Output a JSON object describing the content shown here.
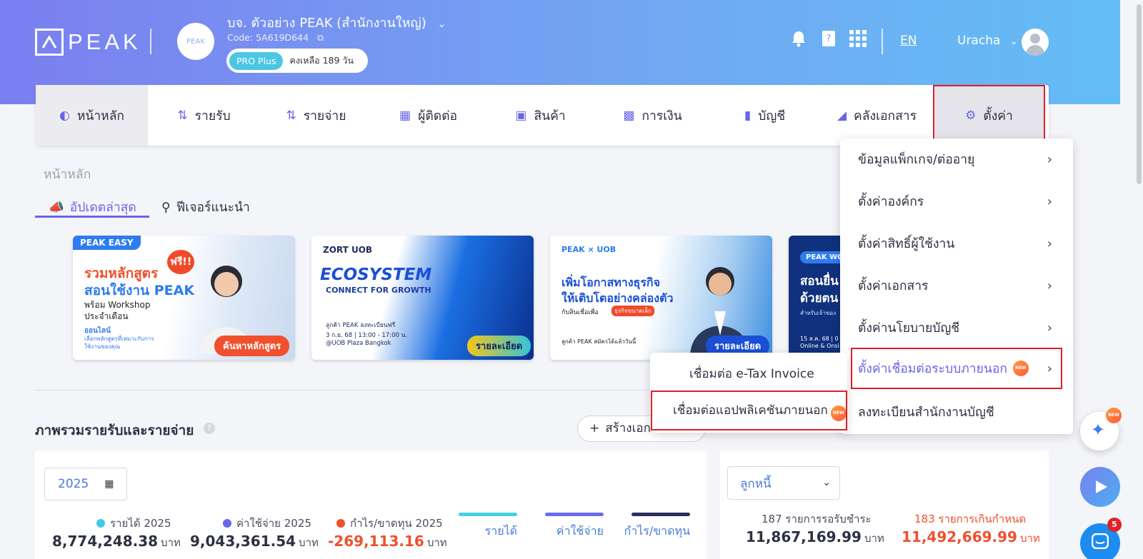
{
  "header": {
    "logo_text": "PEAK",
    "company_name": "บจ. ตัวอย่าง PEAK (สำนักงานใหญ่)",
    "company_logo_text": "PEAK",
    "company_code": "Code: 5A619D644",
    "plan_badge": "PRO Plus",
    "plan_days_left": "คงเหลือ 189 วัน",
    "language": "EN",
    "user_name": "Uracha"
  },
  "nav": {
    "items": [
      {
        "label": "หน้าหลัก",
        "icon": "chart-icon"
      },
      {
        "label": "รายรับ",
        "icon": "income-icon"
      },
      {
        "label": "รายจ่าย",
        "icon": "expense-icon"
      },
      {
        "label": "ผู้ติดต่อ",
        "icon": "contacts-icon"
      },
      {
        "label": "สินค้า",
        "icon": "box-icon"
      },
      {
        "label": "การเงิน",
        "icon": "money-icon"
      },
      {
        "label": "บัญชี",
        "icon": "book-icon"
      },
      {
        "label": "คลังเอกสาร",
        "icon": "folder-icon"
      },
      {
        "label": "ตั้งค่า",
        "icon": "gear-icon"
      }
    ]
  },
  "breadcrumb": "หน้าหลัก",
  "tabs": {
    "updates": "อัปเดตล่าสุด",
    "features": "ฟีเจอร์แนะนำ"
  },
  "banners": {
    "b1": {
      "tag": "PEAK EASY",
      "free": "ฟรี!!",
      "line1": "รวมหลักสูตร",
      "line2": "สอนใช้งาน PEAK",
      "line3": "พร้อม Workshop",
      "line4": "ประจำเดือน",
      "line5": "ออนไลน์",
      "line6": "เลือกหลักสูตรที่เหมาะกับการ",
      "line7": "ใช้งานของคุณ",
      "cta": "ค้นหาหลักสูตร"
    },
    "b2": {
      "brand": "ZORT  UOB",
      "title": "ECOSYSTEM",
      "subtitle": "CONNECT FOR GROWTH",
      "desc1": "ลูกค้า PEAK ลงทะเบียนฟรี",
      "desc2": "3 ก.ย. 68 | 13:00 - 17:00 น.",
      "desc3": "@UOB Plaza Bangkok",
      "cta": "รายละเอียด"
    },
    "b3": {
      "brand": "PEAK × UOB",
      "line1": "เพิ่มโอกาสทางธุรกิจ",
      "line2": "ให้เติบโตอย่างคล่องตัว",
      "line3": "กับสินเชื่อเพื่อ",
      "tag": "ธุรกิจขนาดเล็ก",
      "line4": "ลูกค้า PEAK สมัครได้แล้ววันนี้",
      "cta": "รายละเอียด"
    },
    "b4": {
      "tag": "PEAK WO",
      "line1": "สอนยื่น",
      "line2": "ด้วยตน",
      "line3": "สำหรับเจ้าของ",
      "line4": "15 ส.ค. 68 | 0",
      "line5": "Online & Onsi"
    }
  },
  "overview": {
    "title": "ภาพรวมรายรับและรายจ่าย",
    "help": "?",
    "create_button": "สร้างเอกสาร",
    "year": "2025",
    "stats": [
      {
        "label": "รายได้ 2025",
        "value": "8,774,248.38",
        "unit": "บาท",
        "color": "#45c8e4"
      },
      {
        "label": "ค่าใช้จ่าย 2025",
        "value": "9,043,361.54",
        "unit": "บาท",
        "color": "#6a64e8"
      },
      {
        "label": "กำไร/ขาดทุน 2025",
        "value": "-269,113.16",
        "unit": "บาท",
        "color": "#f0502d"
      }
    ],
    "legend": [
      {
        "label": "รายได้",
        "color": "#45d0e6"
      },
      {
        "label": "ค่าใช้จ่าย",
        "color": "#6a6cf0"
      },
      {
        "label": "กำไร/ขาดทุน",
        "color": "#2b2f5e"
      }
    ]
  },
  "debtors": {
    "select_value": "ลูกหนี้",
    "pending_label": "187 รายการรอรับชำระ",
    "pending_value": "11,867,169.99",
    "overdue_label": "183 รายการเกินกำหนด",
    "overdue_value": "11,492,669.99",
    "unit": "บาท"
  },
  "settings_menu": {
    "items": [
      {
        "label": "ข้อมูลแพ็กเกจ/ต่ออายุ",
        "chevron": "›"
      },
      {
        "label": "ตั้งค่าองค์กร",
        "chevron": "›"
      },
      {
        "label": "ตั้งค่าสิทธิ์ผู้ใช้งาน",
        "chevron": "›"
      },
      {
        "label": "ตั้งค่าเอกสาร",
        "chevron": "›"
      },
      {
        "label": "ตั้งค่านโยบายบัญชี",
        "chevron": "›"
      },
      {
        "label": "ตั้งค่าเชื่อมต่อระบบภายนอก",
        "chevron": "›",
        "new_badge": "NEW"
      },
      {
        "label": "ลงทะเบียนสำนักงานบัญชี",
        "chevron": ""
      }
    ]
  },
  "integration_submenu": {
    "items": [
      {
        "label": "เชื่อมต่อ e-Tax Invoice"
      },
      {
        "label": "เชื่อมต่อแอปพลิเคชันภายนอก",
        "new_badge": "NEW"
      }
    ]
  },
  "fabs": {
    "ai_new_badge": "NEW",
    "chat_count": "5"
  }
}
